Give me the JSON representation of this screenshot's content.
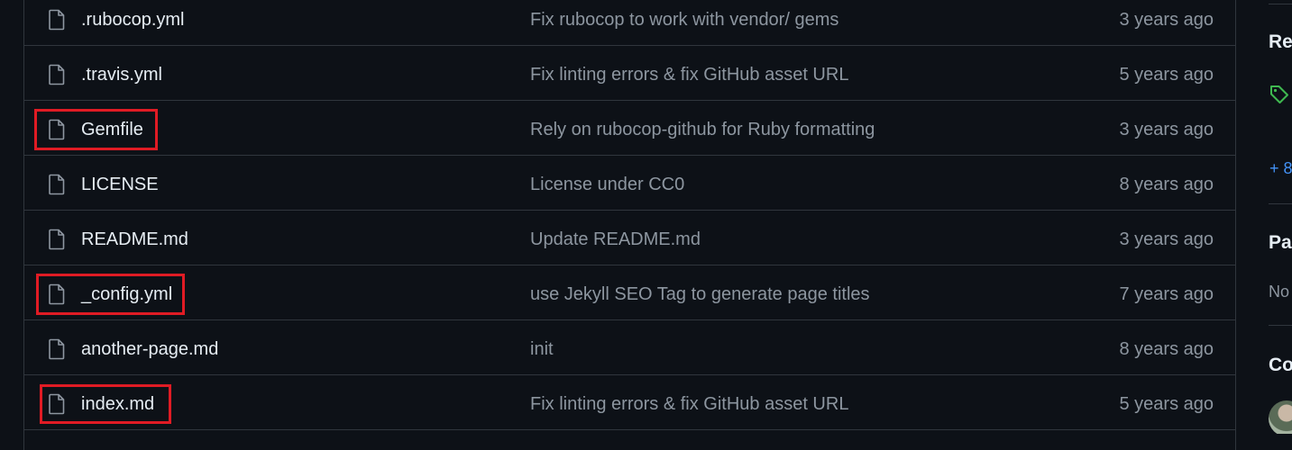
{
  "files": [
    {
      "name": ".rubocop.yml",
      "message": "Fix rubocop to work with vendor/ gems",
      "age": "3 years ago",
      "icon": "file-icon"
    },
    {
      "name": ".travis.yml",
      "message": "Fix linting errors & fix GitHub asset URL",
      "age": "5 years ago",
      "icon": "file-icon"
    },
    {
      "name": "Gemfile",
      "message": "Rely on rubocop-github for Ruby formatting",
      "age": "3 years ago",
      "icon": "file-icon",
      "highlighted": true
    },
    {
      "name": "LICENSE",
      "message": "License under CC0",
      "age": "8 years ago",
      "icon": "file-icon"
    },
    {
      "name": "README.md",
      "message": "Update README.md",
      "age": "3 years ago",
      "icon": "file-icon"
    },
    {
      "name": "_config.yml",
      "message": "use Jekyll SEO Tag to generate page titles",
      "age": "7 years ago",
      "icon": "file-icon",
      "highlighted": true
    },
    {
      "name": "another-page.md",
      "message": "init",
      "age": "8 years ago",
      "icon": "file-icon"
    },
    {
      "name": "index.md",
      "message": "Fix linting errors & fix GitHub asset URL",
      "age": "5 years ago",
      "icon": "file-icon",
      "highlighted": true
    }
  ],
  "sidebar": {
    "releases_heading": "Re",
    "tag_icon": "tag-icon",
    "more_link": "+ 8",
    "packages_heading": "Pa",
    "packages_text": "No",
    "contributors_heading": "Co",
    "avatar": "contributor-avatar"
  },
  "colors": {
    "background": "#0d1117",
    "border": "#30363d",
    "text": "#e6edf3",
    "muted": "#8d96a0",
    "link": "#4493f8",
    "highlight": "#e01b24",
    "tag_green": "#3fb950"
  }
}
